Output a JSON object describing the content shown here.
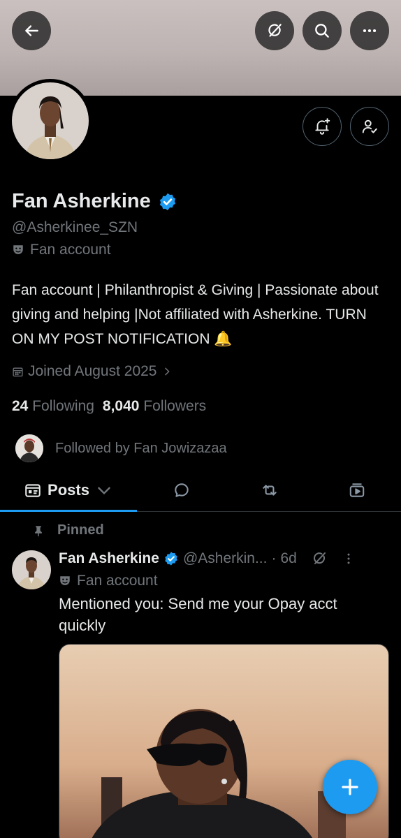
{
  "profile": {
    "name": "Fan Asherkine",
    "handle": "@Asherkinee_SZN",
    "account_label": "Fan account",
    "bio": "Fan account | Philanthropist & Giving | Passionate about giving and helping |Not affiliated with Asherkine. TURN ON MY POST NOTIFICATION 🔔",
    "joined": "Joined August 2025",
    "following_count": "24",
    "following_label": "Following",
    "followers_count": "8,040",
    "followers_label": "Followers",
    "followed_by": "Followed by Fan Jowizazaa"
  },
  "tabs": {
    "posts_label": "Posts"
  },
  "post": {
    "pinned_label": "Pinned",
    "author_name": "Fan Asherkine",
    "author_handle": "@Asherkin...",
    "separator": "·",
    "time": "6d",
    "author_label": "Fan account",
    "text": "Mentioned you: Send me your Opay acct quickly"
  },
  "icons": {
    "back": "arrow-left-icon",
    "grok": "grok-icon",
    "search": "search-icon",
    "more": "more-horizontal-icon",
    "notify": "bell-plus-icon",
    "following": "person-check-icon",
    "verified": "verified-badge-icon",
    "mask": "theater-mask-icon",
    "calendar": "calendar-icon",
    "pin": "pin-icon",
    "compose": "plus-icon"
  },
  "colors": {
    "accent": "#1d9bf0",
    "background": "#000000",
    "text_primary": "#e7e9ea",
    "text_secondary": "#71767b",
    "divider": "#2f3336"
  }
}
